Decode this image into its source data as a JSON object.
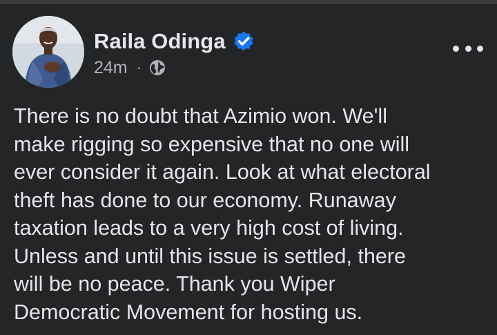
{
  "post": {
    "author": {
      "name": "Raila Odinga",
      "verified": true,
      "avatar_icon": "profile-photo"
    },
    "timestamp": "24m",
    "separator": "·",
    "audience_icon": "globe-icon",
    "menu_icon": "more-horizontal-icon",
    "text_lines": [
      "There is no doubt that Azimio won. We'll",
      "make rigging so expensive that no one will",
      "ever consider it again. Look at what electoral",
      "theft has done to our economy. Runaway",
      "taxation leads to a very high cost of living.",
      "Unless and until this issue is settled, there",
      "will be no peace. Thank you Wiper",
      "Democratic Movement for hosting us."
    ]
  },
  "colors": {
    "background": "#242526",
    "primary_text": "#e4e6eb",
    "secondary_text": "#b0b3b8",
    "verified_badge": "#1877f2"
  }
}
